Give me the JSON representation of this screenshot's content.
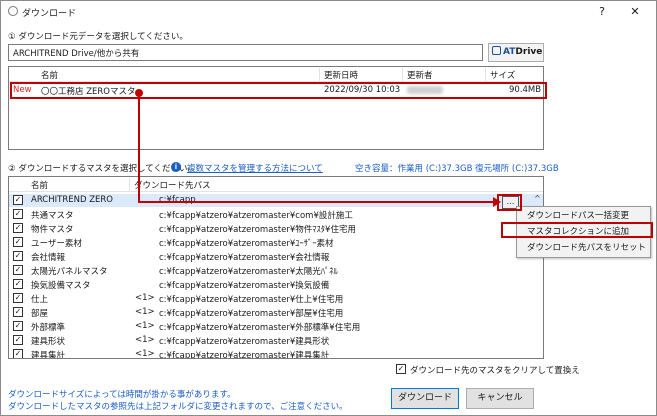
{
  "window": {
    "title": "ダウンロード",
    "help_label": "?",
    "close_label": "✕"
  },
  "source": {
    "label": "① ダウンロード元データを選択してください。",
    "path_value": "ARCHITREND Drive/他から共有",
    "atdrive_label_at": "AT",
    "atdrive_label_drive": "Drive",
    "columns": [
      "名前",
      "更新日時",
      "更新者",
      "サイズ"
    ],
    "rows": [
      {
        "badge": "New",
        "name": "〇〇工務店 ZEROマスタ",
        "updated": "2022/09/30 10:03",
        "size": "90.4MB"
      }
    ]
  },
  "masters": {
    "label": "② ダウンロードするマスタを選択してください。",
    "help_link": "複数マスタを管理する方法について",
    "free_space": "空き容量：作業用 (C:)37.3GB  復元場所 (C:)37.3GB",
    "columns": [
      "名前",
      "ダウンロード先パス"
    ],
    "rows": [
      {
        "name": "ARCHITREND ZERO",
        "prefix": "",
        "path": "c:¥fcapp",
        "checked": true
      },
      {
        "name": "共通マスタ",
        "prefix": "",
        "path": "c:¥fcapp¥atzero¥atzeromaster¥com¥設計施工",
        "checked": true
      },
      {
        "name": "物件マスタ",
        "prefix": "",
        "path": "c:¥fcapp¥atzero¥atzeromaster¥物件ﾏｽﾀ¥住宅用",
        "checked": true
      },
      {
        "name": "ユーザー素材",
        "prefix": "",
        "path": "c:¥fcapp¥atzero¥atzeromaster¥ﾕｰｻﾞｰ素材",
        "checked": true
      },
      {
        "name": "会社情報",
        "prefix": "",
        "path": "c:¥fcapp¥atzero¥atzeromaster¥会社情報",
        "checked": true
      },
      {
        "name": "太陽光パネルマスタ",
        "prefix": "",
        "path": "c:¥fcapp¥atzero¥atzeromaster¥太陽光ﾊﾟﾈﾙ",
        "checked": true
      },
      {
        "name": "換気設備マスタ",
        "prefix": "",
        "path": "c:¥fcapp¥atzero¥atzeromaster¥換気設備",
        "checked": true
      },
      {
        "name": "仕上",
        "prefix": "<1>",
        "path": "c:¥fcapp¥atzero¥atzeromaster¥仕上¥住宅用",
        "checked": true
      },
      {
        "name": "部屋",
        "prefix": "<1>",
        "path": "c:¥fcapp¥atzero¥atzeromaster¥部屋¥住宅用",
        "checked": true
      },
      {
        "name": "外部標準",
        "prefix": "<1>",
        "path": "c:¥fcapp¥atzero¥atzeromaster¥外部標準¥住宅用",
        "checked": true
      },
      {
        "name": "建具形状",
        "prefix": "<1>",
        "path": "c:¥fcapp¥atzero¥atzeromaster¥建具形状",
        "checked": true
      },
      {
        "name": "建具集計",
        "prefix": "<1>",
        "path": "c:¥fcapp¥atzero¥atzeromaster¥建具集計",
        "checked": true
      }
    ],
    "ellipsis_label": "...",
    "scroll_up": "^"
  },
  "context_menu": {
    "items": [
      "ダウンロードパス一括変更",
      "マスタコレクションに追加",
      "ダウンロード先パスをリセット"
    ]
  },
  "footer": {
    "clear_replace_label": "ダウンロード先のマスタをクリアして置換え",
    "note_line1": "ダウンロードサイズによっては時間が掛かる事があります。",
    "note_line2": "ダウンロードしたマスタの参照先は上記フォルダに変更されますので、ご注意ください。",
    "download_button": "ダウンロード",
    "cancel_button": "キャンセル",
    "check_mark": "✓"
  }
}
